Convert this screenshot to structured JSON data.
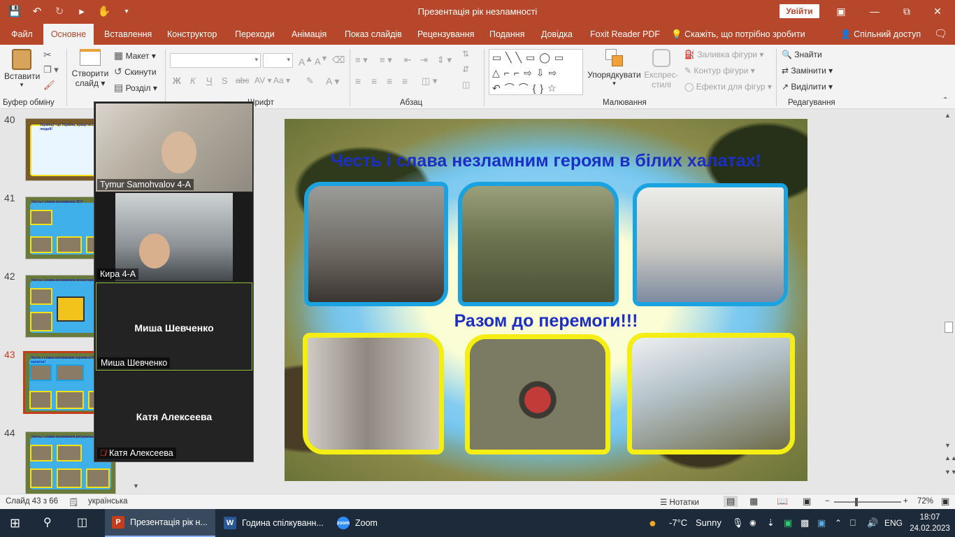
{
  "window": {
    "title": "Презентація рік незламності",
    "signin_label": "Увійти"
  },
  "tabs": [
    "Файл",
    "Основне",
    "Вставлення",
    "Конструктор",
    "Переходи",
    "Анімація",
    "Показ слайдів",
    "Рецензування",
    "Подання",
    "Довідка",
    "Foxit Reader PDF"
  ],
  "tell_me": "Скажіть, що потрібно зробити",
  "share": "Спільний доступ",
  "ribbon": {
    "paste": "Вставити",
    "clipboard_group": "Буфер обміну",
    "new_slide_1": "Створити",
    "new_slide_2": "слайд",
    "layout": "Макет",
    "reset": "Скинути",
    "section": "Розділ",
    "font_group": "Шрифт",
    "bold": "Ж",
    "italic": "К",
    "underline": "Ч",
    "strike": "S",
    "paragraph_group": "Абзац",
    "drawing_group": "Малювання",
    "arrange": "Упорядкувати",
    "quick_styles_1": "Експрес-",
    "quick_styles_2": "стилі",
    "shape_fill": "Заливка фігури",
    "shape_outline": "Контур фігури",
    "shape_effects": "Ефекти для фігур",
    "find": "Знайти",
    "replace": "Замінити",
    "select": "Виділити",
    "editing_group": "Редагування"
  },
  "thumbnails": [
    {
      "num": "40",
      "text": "Українці –це Україна, кращі незламних людей!"
    },
    {
      "num": "41",
      "text": "Честь і слава незламним ЗСУ"
    },
    {
      "num": "42",
      "text": "Честь і слава незламним волонтерам"
    },
    {
      "num": "43",
      "text": "Честь і слава незламним героям в білих халатах!"
    },
    {
      "num": "44",
      "text": "Честь і слава незламним рятувальникам"
    }
  ],
  "zoom": {
    "participants": [
      {
        "name": "Tymur Samohvalov 4-A",
        "video": true
      },
      {
        "name": "Кира 4-А",
        "video": true
      },
      {
        "name": "Миша Шевченко",
        "video": false
      },
      {
        "name": "Катя Алексеева",
        "video": false
      }
    ]
  },
  "slide": {
    "title": "Честь і слава незламним героям в білих халатах!",
    "subtitle": "Разом до перемоги!!!"
  },
  "status": {
    "slide_counter": "Слайд 43 з 66",
    "language": "українська",
    "notes": "Нотатки",
    "zoom_level": "72%"
  },
  "taskbar": {
    "apps": [
      "Презентація рік н...",
      "Година спілкуванн...",
      "Zoom"
    ],
    "weather_temp": "-7°C",
    "weather_desc": "Sunny",
    "lang": "ENG",
    "time": "18:07",
    "date": "24.02.2023"
  },
  "colors": {
    "accent": "#b7472a",
    "slide_title": "#1b2fc4",
    "frame_blue": "#1aa3e0",
    "frame_yellow": "#f5ee14"
  }
}
